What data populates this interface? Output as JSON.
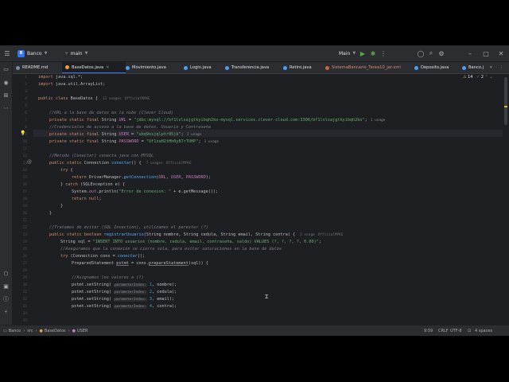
{
  "titlebar": {
    "project_badge": "B",
    "project": "Banco",
    "branch": "main",
    "run_config": "Main"
  },
  "tabs": [
    {
      "label": "README.md",
      "color": "#7c8ba3"
    },
    {
      "label": "BaseDatos.java",
      "color": "#e9a23b",
      "active": true
    },
    {
      "label": "Movimiento.java",
      "color": "#4a9ff5"
    },
    {
      "label": "Login.java",
      "color": "#4a9ff5"
    },
    {
      "label": "Transferencia.java",
      "color": "#4a9ff5"
    },
    {
      "label": "Retiro.java",
      "color": "#4a9ff5"
    },
    {
      "label": "SistemaBancario_Tarea10_jar.xml",
      "color": "#d0624b"
    },
    {
      "label": "Deposito.java",
      "color": "#4a9ff5"
    },
    {
      "label": "Banco.j",
      "color": "#4a9ff5"
    }
  ],
  "editor": {
    "inspection_warnings": "14",
    "inspection_checks": "2",
    "line_numbers": [
      "1",
      "2",
      "3",
      "4",
      "5",
      "6",
      "7",
      "8",
      "9",
      "10",
      "11",
      "12",
      "13",
      "14",
      "15",
      "16",
      "17",
      "18",
      "19",
      "20",
      "21",
      "22",
      "23",
      "24",
      "25",
      "26",
      "27",
      "28",
      "29",
      "30",
      "31",
      "32",
      "33",
      "34",
      "35"
    ],
    "code": {
      "l1a": "import ",
      "l1b": "java.sql.*;",
      "l2a": "import ",
      "l2b": "java.util.ArrayList;",
      "l4a": "public class ",
      "l4b": "BaseDatos {",
      "l4c": "11 usages",
      "l4d": "OfficialMYKE",
      "l6": "//URL a la base de datos en la nube (Clever Cloud)",
      "l7a": "private static final ",
      "l7b": "String ",
      "l7c": "URL",
      "l7d": " = ",
      "l7e": "\"jdbc:mysql://bf1lvlsajgtkyibqh2ko-mysql.services.clever-cloud.com:3306/bf1lvlsajgtkyibqh2ko\"",
      "l7f": ";",
      "l7g": "1 usage",
      "l8": "//Credenciales de acceso a la base de datos, Usuario y Contraseña",
      "l9a": "private static final ",
      "l9b": "String ",
      "l9c": "USER",
      "l9d": " = ",
      "l9e": "\"ubq9osjqlptr95jk\"",
      "l9f": ";",
      "l9g": "1 usage",
      "l10a": "private static final ",
      "l10b": "String ",
      "l10c": "PASSWORD",
      "l10d": " = ",
      "l10e": "\"Uf1zaH2tHh0y87rTUHP\"",
      "l10f": ";",
      "l10g": "1 usage",
      "l12": "//Metodo (Conectar) conecta java con MYSQL",
      "l13a": "public static ",
      "l13b": "Connection ",
      "l13c": "conectar",
      "l13d": "() {",
      "l13e": "7 usages",
      "l13f": "OfficialMYKE",
      "l14a": "try",
      "l14b": " {",
      "l15a": "return ",
      "l15b": "DriverManager.",
      "l15c": "getConnection",
      "l15d": "(",
      "l15e": "URL",
      "l15f": ", ",
      "l15g": "USER",
      "l15h": ", ",
      "l15i": "PASSWORD",
      "l15j": ");",
      "l16a": "} ",
      "l16b": "catch",
      "l16c": " (SQLException e) {",
      "l17a": "System.",
      "l17b": "out",
      "l17c": ".println(",
      "l17d": "\"Error de conexion: \"",
      "l17e": " + e.getMessage());",
      "l18a": "return ",
      "l18b": "null",
      "l18c": ";",
      "l19": "}",
      "l20": "}",
      "l22": "//Tratamos de evitar (SQL Invection), utilizamos el parester (?)",
      "l23a": "public static ",
      "l23b": "boolean ",
      "l23c": "registrarUsuario",
      "l23d": "(String nombre, String cedula, String email, String contra) {",
      "l23e": "1 usage",
      "l23f": "OfficialMYKE",
      "l24a": "String sql = ",
      "l24b": "\"INSERT INTO usuarios (nombre, cedula, email, contraseña, saldo) VALUES (?, ?, ?, ?, 0.00)\"",
      "l24c": ";",
      "l25": "//Aseguramos que la conexion se cierre sola, para evitar saturaciones en la base de datos",
      "l26a": "try",
      "l26b": " (Connection cons = ",
      "l26c": "conectar",
      "l26d": "();",
      "l27a": "PreparedStatement ",
      "l27b": "pstmt",
      "l27c": " = cons.",
      "l27d": "prepareStatement",
      "l27e": "(sql)) {",
      "l29": "//Asignamos los valores a (?)",
      "l30a": "pstmt.setString( ",
      "l30b": "parameterIndex:",
      "l30c": " 1",
      "l30d": ", nombre);",
      "l31a": "pstmt.setString( ",
      "l31b": "parameterIndex:",
      "l31c": " 2",
      "l31d": ", cedula);",
      "l32a": "pstmt.setString( ",
      "l32b": "parameterIndex:",
      "l32c": " 3",
      "l32d": ", email);",
      "l33a": "pstmt.setString( ",
      "l33b": "parameterIndex:",
      "l33c": " 4",
      "l33d": ", contra);"
    }
  },
  "statusbar": {
    "crumbs": [
      "Banco",
      "src",
      "BaseDatos",
      "USER"
    ],
    "position": "9:59",
    "line_sep": "CRLF",
    "encoding": "UTF-8",
    "indent": "4 spaces"
  },
  "colors": {
    "accent": "#3574f0",
    "bg": "#1e1f22",
    "panel": "#2b2d30"
  }
}
